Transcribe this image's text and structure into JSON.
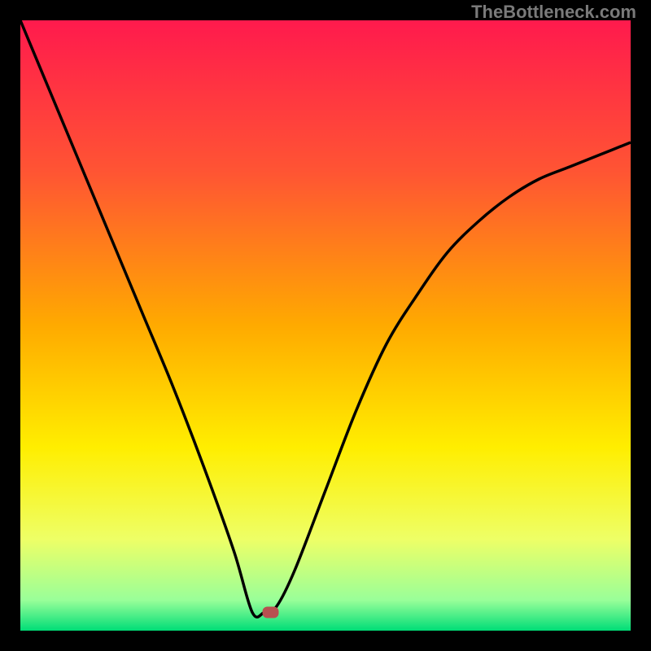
{
  "watermark": "TheBottleneck.com",
  "chart_data": {
    "type": "line",
    "title": "",
    "xlabel": "",
    "ylabel": "",
    "xlim": [
      0,
      100
    ],
    "ylim": [
      0,
      100
    ],
    "background_gradient": {
      "type": "vertical",
      "stops": [
        {
          "offset": 0,
          "color": "#ff1a4d"
        },
        {
          "offset": 25,
          "color": "#ff5533"
        },
        {
          "offset": 50,
          "color": "#ffaa00"
        },
        {
          "offset": 70,
          "color": "#ffee00"
        },
        {
          "offset": 85,
          "color": "#eeff66"
        },
        {
          "offset": 95,
          "color": "#99ff99"
        },
        {
          "offset": 100,
          "color": "#00dd77"
        }
      ]
    },
    "series": [
      {
        "name": "bottleneck-curve",
        "type": "curve",
        "color": "#000000",
        "x": [
          0,
          5,
          10,
          15,
          20,
          25,
          30,
          35,
          38,
          40,
          42,
          45,
          50,
          55,
          60,
          65,
          70,
          75,
          80,
          85,
          90,
          95,
          100
        ],
        "y": [
          100,
          88,
          76,
          64,
          52,
          40,
          27,
          13,
          3,
          3,
          4,
          10,
          23,
          36,
          47,
          55,
          62,
          67,
          71,
          74,
          76,
          78,
          80
        ]
      }
    ],
    "marker": {
      "x": 41,
      "y": 3,
      "color": "#b85050",
      "shape": "rounded-rect"
    }
  }
}
